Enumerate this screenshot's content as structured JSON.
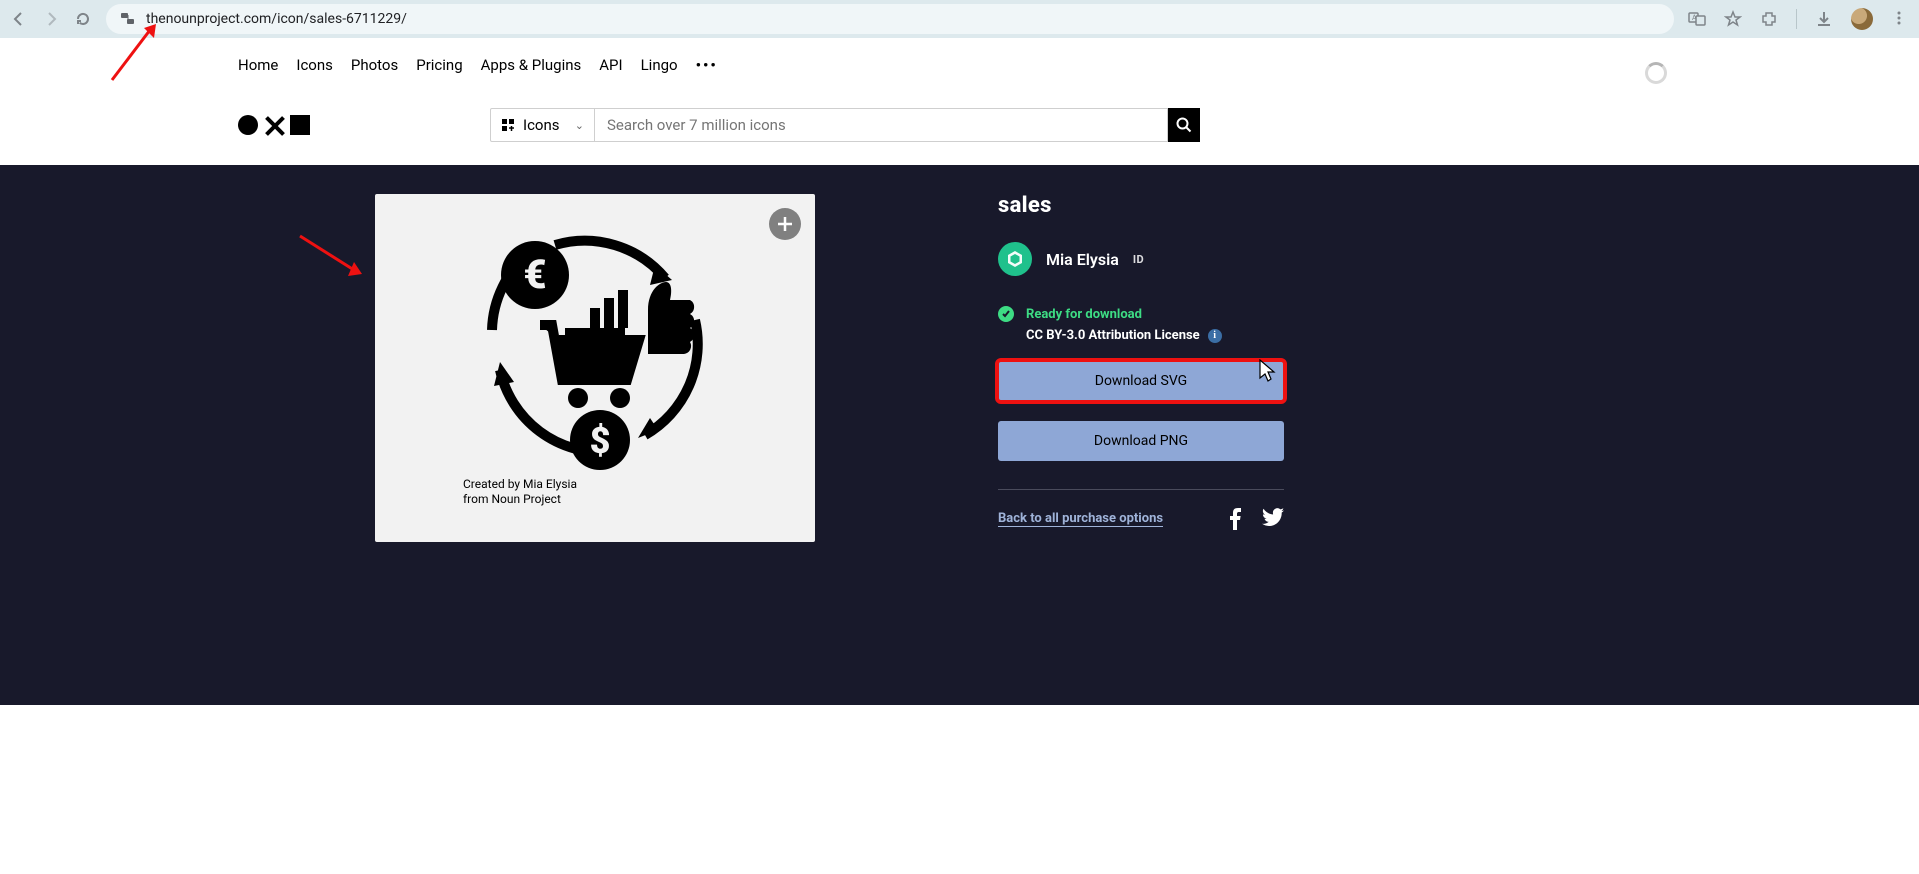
{
  "browser": {
    "url": "thenounproject.com/icon/sales-6711229/"
  },
  "nav": {
    "items": [
      "Home",
      "Icons",
      "Photos",
      "Pricing",
      "Apps & Plugins",
      "API",
      "Lingo"
    ],
    "more": "•••"
  },
  "search": {
    "category": "Icons",
    "placeholder": "Search over 7 million icons"
  },
  "icon_card": {
    "credit_line1": "Created by Mia Elysia",
    "credit_line2": "from Noun Project"
  },
  "detail": {
    "title": "sales",
    "author_name": "Mia Elysia",
    "author_country": "ID",
    "ready_text": "Ready for download",
    "license_text": "CC BY-3.0 Attribution License",
    "download_svg": "Download SVG",
    "download_png": "Download PNG",
    "back_link": "Back to all purchase options"
  }
}
